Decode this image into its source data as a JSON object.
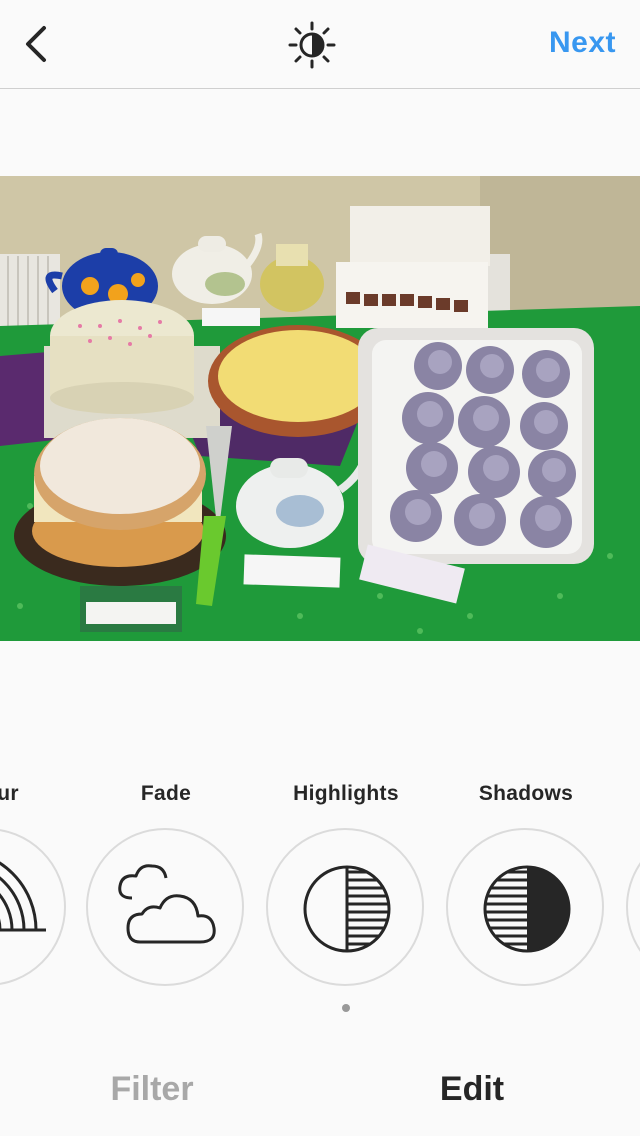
{
  "header": {
    "back_icon": "chevron-left-icon",
    "lux_icon": "sun-half-icon",
    "next_label": "Next",
    "accent_color": "#3897f0"
  },
  "photo": {
    "description_icon": "photo-preview"
  },
  "tools": [
    {
      "label": "ur",
      "icon": "rainbow-icon"
    },
    {
      "label": "Fade",
      "icon": "clouds-icon"
    },
    {
      "label": "Highlights",
      "icon": "highlights-circle-icon"
    },
    {
      "label": "Shadows",
      "icon": "shadows-circle-icon"
    }
  ],
  "tabs": {
    "filter_label": "Filter",
    "edit_label": "Edit"
  }
}
